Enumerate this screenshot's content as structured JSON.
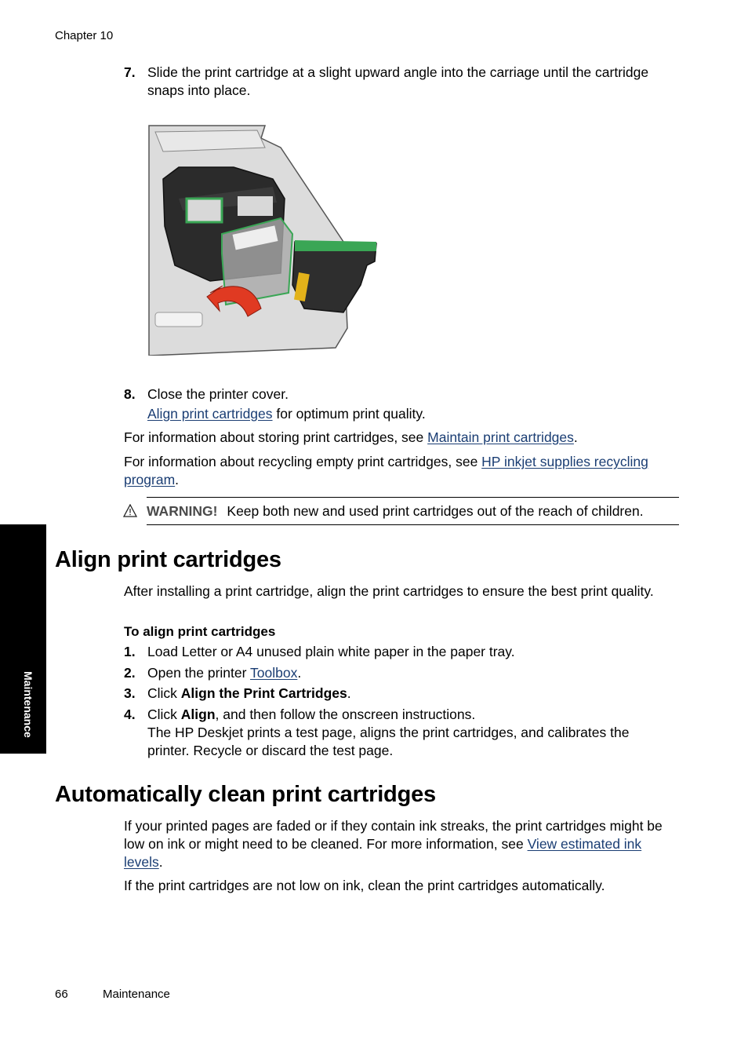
{
  "header": {
    "running_title": "Chapter 10"
  },
  "steps_top": [
    {
      "num": "7.",
      "text": "Slide the print cartridge at a slight upward angle into the carriage until the cartridge snaps into place."
    },
    {
      "num": "8.",
      "text": "Close the printer cover.",
      "note_link": "Align print cartridges",
      "note_rest": " for optimum print quality."
    }
  ],
  "figure": {
    "icon": "print-cartridge-insertion-illustration",
    "arrow_color": "#e03a22",
    "cartridge_frame_color": "#3aa655"
  },
  "paragraphs": {
    "storing": {
      "before": "For information about storing print cartridges, see ",
      "link": "Maintain print cartridges",
      "after": "."
    },
    "recycling": {
      "before": "For information about recycling empty print cartridges, see ",
      "link": "HP inkjet supplies recycling program",
      "after": "."
    }
  },
  "warning": {
    "icon": "warning-triangle-icon",
    "label": "WARNING!",
    "text": "Keep both new and used print cartridges out of the reach of children."
  },
  "align_section": {
    "heading": "Align print cartridges",
    "intro": "After installing a print cartridge, align the print cartridges to ensure the best print quality.",
    "procedure_title": "To align print cartridges",
    "steps": [
      {
        "num": "1.",
        "text": "Load Letter or A4 unused plain white paper in the paper tray."
      },
      {
        "num": "2.",
        "before": "Open the printer ",
        "link": "Toolbox",
        "after": "."
      },
      {
        "num": "3.",
        "before": "Click ",
        "bold": "Align the Print Cartridges",
        "after": "."
      },
      {
        "num": "4.",
        "before": "Click ",
        "bold": "Align",
        "after": ", and then follow the onscreen instructions.",
        "note": "The HP Deskjet prints a test page, aligns the print cartridges, and calibrates the printer. Recycle or discard the test page."
      }
    ]
  },
  "clean_section": {
    "heading": "Automatically clean print cartridges",
    "p1_before": "If your printed pages are faded or if they contain ink streaks, the print cartridges might be low on ink or might need to be cleaned. For more information, see ",
    "p1_link": "View estimated ink levels",
    "p1_after": ".",
    "p2": "If the print cartridges are not low on ink, clean the print cartridges automatically."
  },
  "side_tab": {
    "label": "Maintenance"
  },
  "footer": {
    "page_number": "66",
    "section": "Maintenance"
  },
  "colors": {
    "link": "#1a3d73",
    "warning_label": "#4a4a4a",
    "side_tab_bg": "#000000"
  }
}
